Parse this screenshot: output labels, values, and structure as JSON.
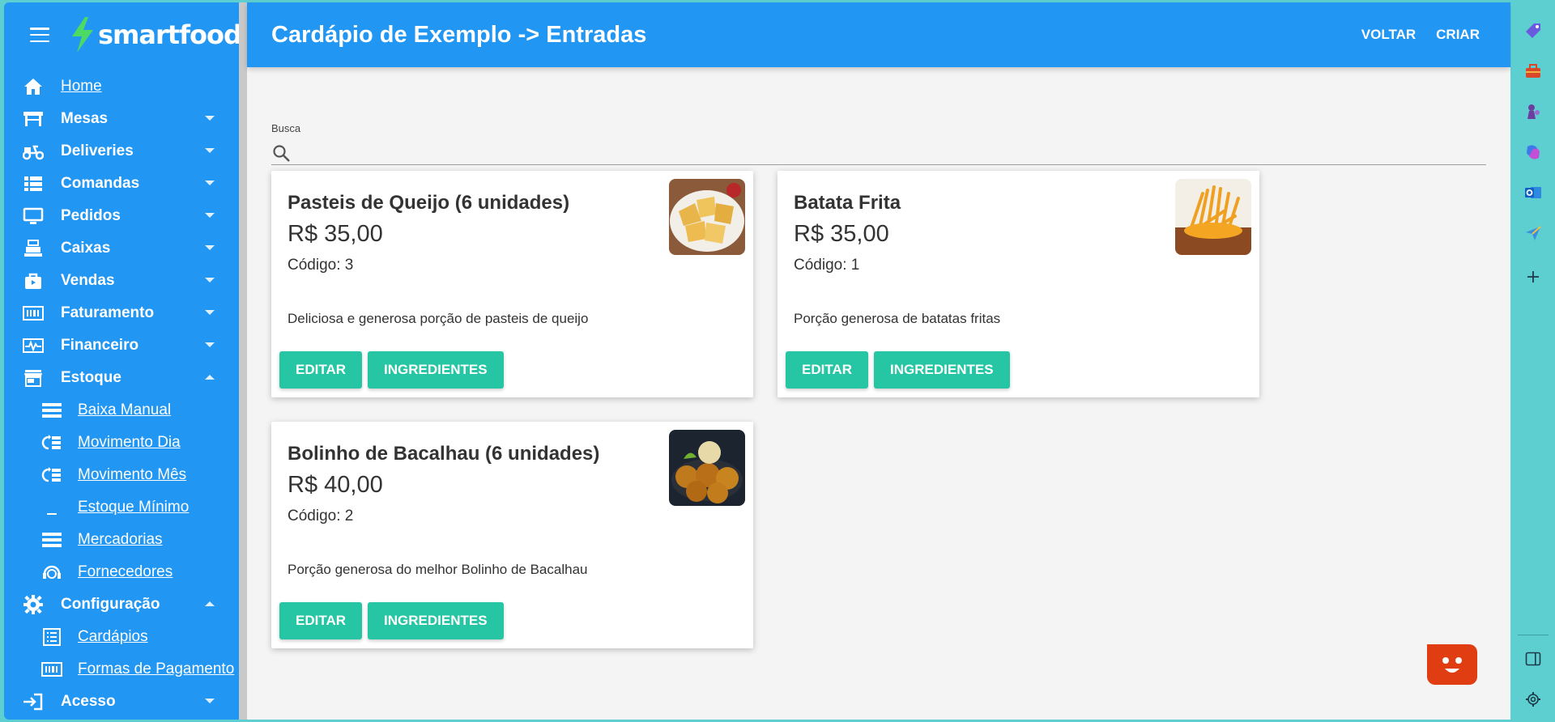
{
  "brand": {
    "name": "smartfood"
  },
  "sidebar": {
    "items": [
      {
        "label": "Home",
        "icon": "home-icon",
        "link": true
      },
      {
        "label": "Mesas",
        "icon": "table-icon",
        "caret": "down"
      },
      {
        "label": "Deliveries",
        "icon": "moped-icon",
        "caret": "down"
      },
      {
        "label": "Comandas",
        "icon": "list-icon",
        "caret": "down"
      },
      {
        "label": "Pedidos",
        "icon": "monitor-icon",
        "caret": "down"
      },
      {
        "label": "Caixas",
        "icon": "cash-register-icon",
        "caret": "down"
      },
      {
        "label": "Vendas",
        "icon": "shopping-bag-icon",
        "caret": "down"
      },
      {
        "label": "Faturamento",
        "icon": "barcode-icon",
        "caret": "down"
      },
      {
        "label": "Financeiro",
        "icon": "pulse-icon",
        "caret": "down"
      },
      {
        "label": "Estoque",
        "icon": "store-icon",
        "caret": "up"
      }
    ],
    "estoque_sub": [
      {
        "label": "Baixa Manual",
        "icon": "list-icon"
      },
      {
        "label": "Movimento Dia",
        "icon": "sync-list-icon"
      },
      {
        "label": "Movimento Mês",
        "icon": "sync-list-icon"
      },
      {
        "label": "Estoque Mínimo",
        "icon": "underscore-icon"
      },
      {
        "label": "Mercadorias",
        "icon": "list-icon"
      },
      {
        "label": "Fornecedores",
        "icon": "support-agent-icon"
      }
    ],
    "config": {
      "label": "Configuração",
      "icon": "gear-icon",
      "caret": "up"
    },
    "config_sub": [
      {
        "label": "Cardápios",
        "icon": "menu-book-icon"
      },
      {
        "label": "Formas de Pagamento",
        "icon": "barcode-icon"
      }
    ],
    "acesso": {
      "label": "Acesso",
      "icon": "login-icon",
      "caret": "down"
    }
  },
  "header": {
    "title": "Cardápio de Exemplo -> Entradas",
    "actions": {
      "back": "VOLTAR",
      "create": "CRIAR"
    }
  },
  "search": {
    "label": "Busca",
    "value": ""
  },
  "cards": [
    {
      "title": "Pasteis de Queijo (6 unidades)",
      "price": "R$ 35,00",
      "code": "Código: 3",
      "description": "Deliciosa e generosa porção de pasteis de queijo",
      "edit": "EDITAR",
      "ingredients": "INGREDIENTES",
      "image": "pasteis-photo"
    },
    {
      "title": "Batata Frita",
      "price": "R$ 35,00",
      "code": "Código: 1",
      "description": "Porção generosa de batatas fritas",
      "edit": "EDITAR",
      "ingredients": "INGREDIENTES",
      "image": "fries-photo"
    },
    {
      "title": "Bolinho de Bacalhau (6 unidades)",
      "price": "R$ 40,00",
      "code": "Código: 2",
      "description": "Porção generosa do melhor Bolinho de Bacalhau",
      "edit": "EDITAR",
      "ingredients": "INGREDIENTES",
      "image": "bolinho-photo"
    }
  ],
  "rail": {
    "icons": [
      "tag-icon",
      "toolbox-icon",
      "chess-icon",
      "copilot-icon",
      "outlook-icon",
      "send-icon",
      "plus-icon",
      "sidebar-toggle-icon",
      "settings-icon"
    ]
  },
  "colors": {
    "primary": "#2196f3",
    "accent": "#26c6a4",
    "background": "#f4f4f4",
    "frame": "#5ecfd0",
    "chat": "#e03d12"
  }
}
